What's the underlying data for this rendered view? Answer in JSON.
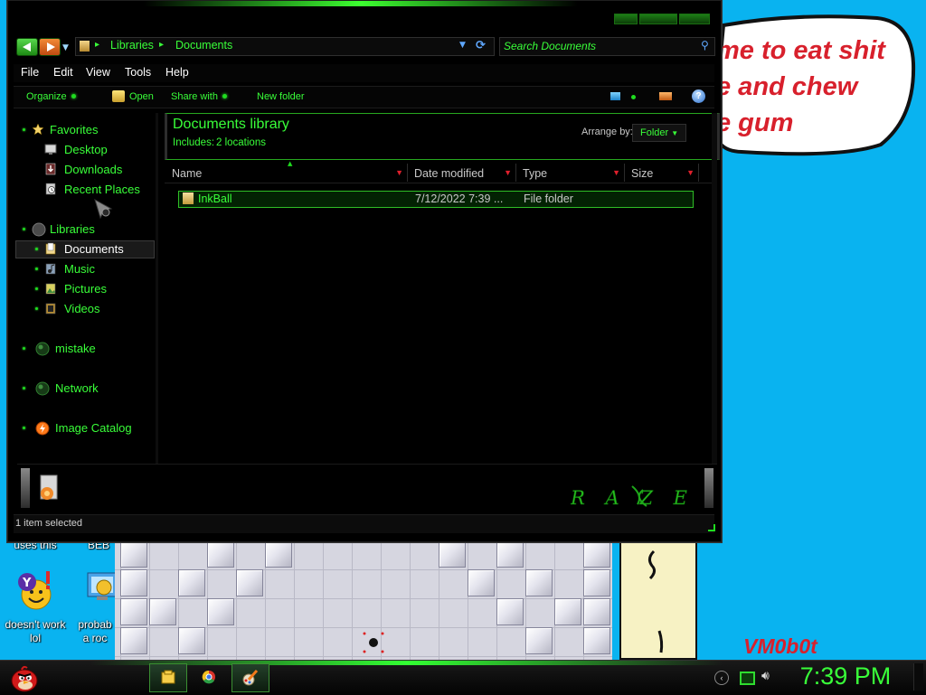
{
  "desktop": {
    "bubble_text": "me to eat shit\ne and chew\ne gum",
    "signature": "VM0b0t",
    "icons": [
      {
        "label": "uses this"
      },
      {
        "label": "BEB"
      },
      {
        "label": "doesn't work\nlol"
      },
      {
        "label": "probab\na roc"
      }
    ]
  },
  "window": {
    "breadcrumb": [
      "Libraries",
      "Documents"
    ],
    "search_placeholder": "Search Documents",
    "menu": [
      "File",
      "Edit",
      "View",
      "Tools",
      "Help"
    ],
    "commands": {
      "organize": "Organize",
      "open": "Open",
      "share": "Share with",
      "new_folder": "New folder"
    },
    "sidebar": {
      "favorites": "Favorites",
      "desktop": "Desktop",
      "downloads": "Downloads",
      "recent": "Recent Places",
      "libraries": "Libraries",
      "documents": "Documents",
      "music": "Music",
      "pictures": "Pictures",
      "videos": "Videos",
      "mistake": "mistake",
      "network": "Network",
      "image_catalog": "Image Catalog"
    },
    "library": {
      "title": "Documents library",
      "includes_label": "Includes:",
      "includes_link": "2 locations",
      "arrange_label": "Arrange by:",
      "arrange_value": "Folder"
    },
    "columns": [
      "Name",
      "Date modified",
      "Type",
      "Size"
    ],
    "rows": [
      {
        "name": "InkBall",
        "date": "7/12/2022 7:39 ...",
        "type": "File folder",
        "size": ""
      }
    ],
    "brand": "RAZER",
    "status": "1 item selected"
  },
  "taskbar": {
    "clock": "7:39 PM"
  }
}
